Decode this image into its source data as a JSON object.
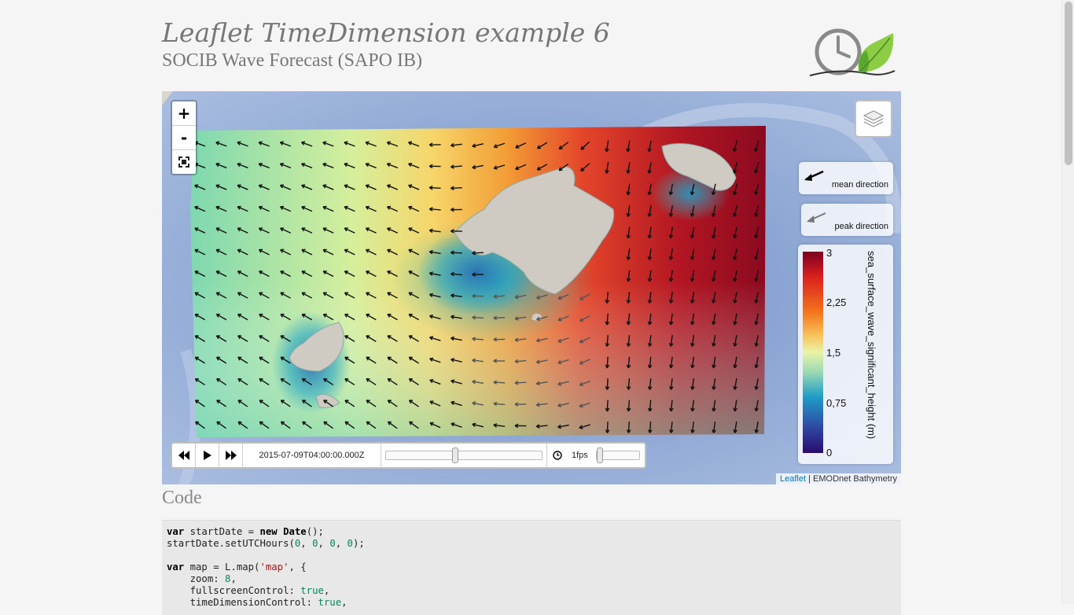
{
  "page": {
    "title": "Leaflet TimeDimension example 6",
    "subtitle": "SOCIB Wave Forecast (SAPO IB)"
  },
  "map": {
    "zoom_in_label": "+",
    "zoom_out_label": "-",
    "legend": {
      "mean_direction": "mean direction",
      "peak_direction": "peak direction"
    },
    "colorscale": {
      "variable": "sea_surface_wave_significant_height (m)",
      "ticks": [
        "3",
        "2,25",
        "1,5",
        "0,75",
        "0"
      ],
      "colors": [
        "#7a0020",
        "#d81e1e",
        "#f4741c",
        "#f8c65e",
        "#e9f3a8",
        "#9ad8b4",
        "#1e9ec5",
        "#2e4fa6",
        "#2a0a6e"
      ]
    },
    "time_control": {
      "datetime": "2015-07-09T04:00:00.000Z",
      "speed": "1fps",
      "timeline_position": 0.44,
      "speed_position": 0.0
    },
    "attribution": {
      "link": "Leaflet",
      "separator": " | ",
      "text": "EMODnet Bathymetry"
    }
  },
  "code": {
    "heading": "Code",
    "lines": [
      [
        {
          "t": "kw",
          "v": "var"
        },
        {
          "t": "p",
          "v": " startDate = "
        },
        {
          "t": "kw",
          "v": "new"
        },
        {
          "t": "p",
          "v": " "
        },
        {
          "t": "kw",
          "v": "Date"
        },
        {
          "t": "p",
          "v": "();"
        }
      ],
      [
        {
          "t": "p",
          "v": "startDate.setUTCHours("
        },
        {
          "t": "num",
          "v": "0"
        },
        {
          "t": "p",
          "v": ", "
        },
        {
          "t": "num",
          "v": "0"
        },
        {
          "t": "p",
          "v": ", "
        },
        {
          "t": "num",
          "v": "0"
        },
        {
          "t": "p",
          "v": ", "
        },
        {
          "t": "num",
          "v": "0"
        },
        {
          "t": "p",
          "v": ");"
        }
      ],
      [
        {
          "t": "p",
          "v": ""
        }
      ],
      [
        {
          "t": "kw",
          "v": "var"
        },
        {
          "t": "p",
          "v": " map = L.map("
        },
        {
          "t": "str",
          "v": "'map'"
        },
        {
          "t": "p",
          "v": ", {"
        }
      ],
      [
        {
          "t": "p",
          "v": "    zoom: "
        },
        {
          "t": "num",
          "v": "8"
        },
        {
          "t": "p",
          "v": ","
        }
      ],
      [
        {
          "t": "p",
          "v": "    fullscreenControl: "
        },
        {
          "t": "bool",
          "v": "true"
        },
        {
          "t": "p",
          "v": ","
        }
      ],
      [
        {
          "t": "p",
          "v": "    timeDimensionControl: "
        },
        {
          "t": "bool",
          "v": "true"
        },
        {
          "t": "p",
          "v": ","
        }
      ]
    ]
  }
}
